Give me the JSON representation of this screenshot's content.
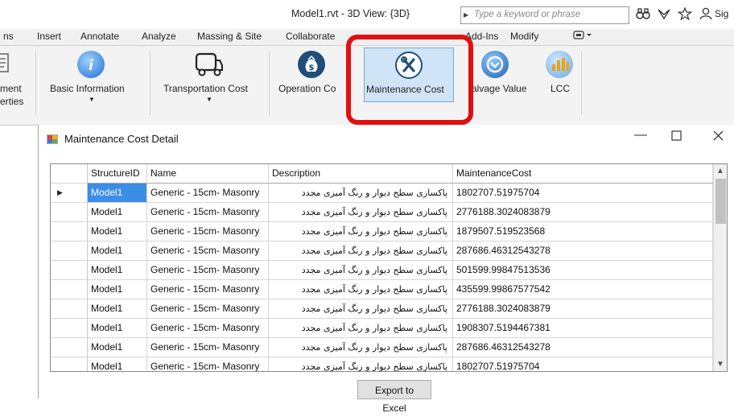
{
  "window": {
    "title": "Model1.rvt - 3D View: {3D}",
    "search_placeholder": "Type a keyword or phrase",
    "signin": "Sig"
  },
  "ribbon": {
    "tabs": [
      "ns",
      "Insert",
      "Annotate",
      "Analyze",
      "Massing & Site",
      "Collaborate",
      "Add-Ins",
      "Modify"
    ],
    "left_cut_label_1": "ment",
    "left_cut_label_2": "erties",
    "buttons": [
      {
        "label": "Basic Information",
        "icon": "info-icon"
      },
      {
        "label": "Transportation Cost",
        "icon": "truck-icon"
      },
      {
        "label": "Operation Co",
        "icon": "money-bag-icon"
      },
      {
        "label": "Maintenance Cost",
        "icon": "tools-icon"
      },
      {
        "label": "alvage Value",
        "icon": "recycle-icon"
      },
      {
        "label": "LCC",
        "icon": "bar-chart-icon"
      }
    ]
  },
  "dialog": {
    "title": "Maintenance Cost Detail",
    "columns": [
      "StructureID",
      "Name",
      "Description",
      "MaintenanceCost"
    ],
    "rows": [
      [
        "Model1",
        "Generic - 15cm- Masonry",
        "پاکسازی سطح دیوار و رنگ آمیزی مجدد",
        "1802707.51975704"
      ],
      [
        "Model1",
        "Generic - 15cm- Masonry",
        "پاکسازی سطح دیوار و رنگ آمیزی مجدد",
        "2776188.3024083879"
      ],
      [
        "Model1",
        "Generic - 15cm- Masonry",
        "پاکسازی سطح دیوار و رنگ آمیزی مجدد",
        "1879507.519523568"
      ],
      [
        "Model1",
        "Generic - 15cm- Masonry",
        "پاکسازی سطح دیوار و رنگ آمیزی مجدد",
        "287686.46312543278"
      ],
      [
        "Model1",
        "Generic - 15cm- Masonry",
        "پاکسازی سطح دیوار و رنگ آمیزی مجدد",
        "501599.99847513536"
      ],
      [
        "Model1",
        "Generic - 15cm- Masonry",
        "پاکسازی سطح دیوار و رنگ آمیزی مجدد",
        "435599.99867577542"
      ],
      [
        "Model1",
        "Generic - 15cm- Masonry",
        "پاکسازی سطح دیوار و رنگ آمیزی مجدد",
        "2776188.3024083879"
      ],
      [
        "Model1",
        "Generic - 15cm- Masonry",
        "پاکسازی سطح دیوار و رنگ آمیزی مجدد",
        "1908307.5194467381"
      ],
      [
        "Model1",
        "Generic - 15cm- Masonry",
        "پاکسازی سطح دیوار و رنگ آمیزی مجدد",
        "287686.46312543278"
      ],
      [
        "Model1",
        "Generic - 15cm- Masonry",
        "پاکسازی سطح دیوار و رنگ آمیزی مجدد",
        "1802707.51975704"
      ]
    ],
    "export_label": "Export to Excel"
  },
  "colors": {
    "highlight_red": "#e01010",
    "selection_blue": "#3a8ee6",
    "ribbon_active": "#cfe4f7"
  }
}
